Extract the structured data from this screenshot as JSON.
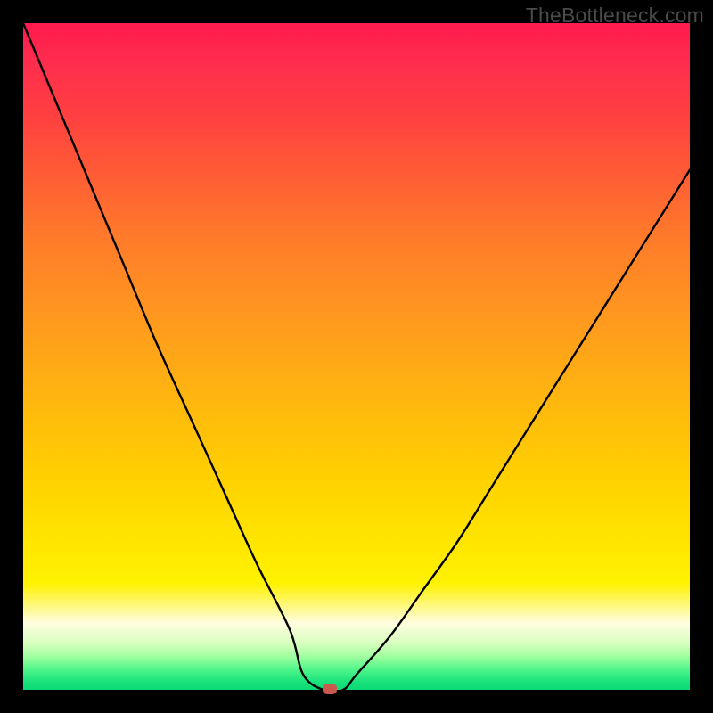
{
  "watermark": "TheBottleneck.com",
  "chart_data": {
    "type": "line",
    "title": "",
    "xlabel": "",
    "ylabel": "",
    "xlim": [
      0,
      100
    ],
    "ylim": [
      0,
      100
    ],
    "series": [
      {
        "name": "bottleneck-curve",
        "x": [
          0,
          5,
          10,
          15,
          20,
          25,
          30,
          35,
          40,
          42,
          45,
          48,
          50,
          55,
          60,
          65,
          70,
          75,
          80,
          85,
          90,
          95,
          100
        ],
        "values": [
          100,
          88,
          76,
          64,
          52,
          41,
          30,
          19,
          9,
          2.3,
          0,
          0,
          2.3,
          8,
          15,
          22,
          30,
          38,
          46,
          54,
          62,
          70,
          78
        ]
      }
    ],
    "markers": [
      {
        "name": "optimal-point",
        "x": 46,
        "y": 0.2
      }
    ],
    "background_gradient": {
      "orientation": "vertical",
      "stops": [
        {
          "pos": 0.0,
          "color": "#ff1a4d"
        },
        {
          "pos": 0.5,
          "color": "#ffb50f"
        },
        {
          "pos": 0.85,
          "color": "#fff200"
        },
        {
          "pos": 1.0,
          "color": "#0cd976"
        }
      ]
    }
  }
}
